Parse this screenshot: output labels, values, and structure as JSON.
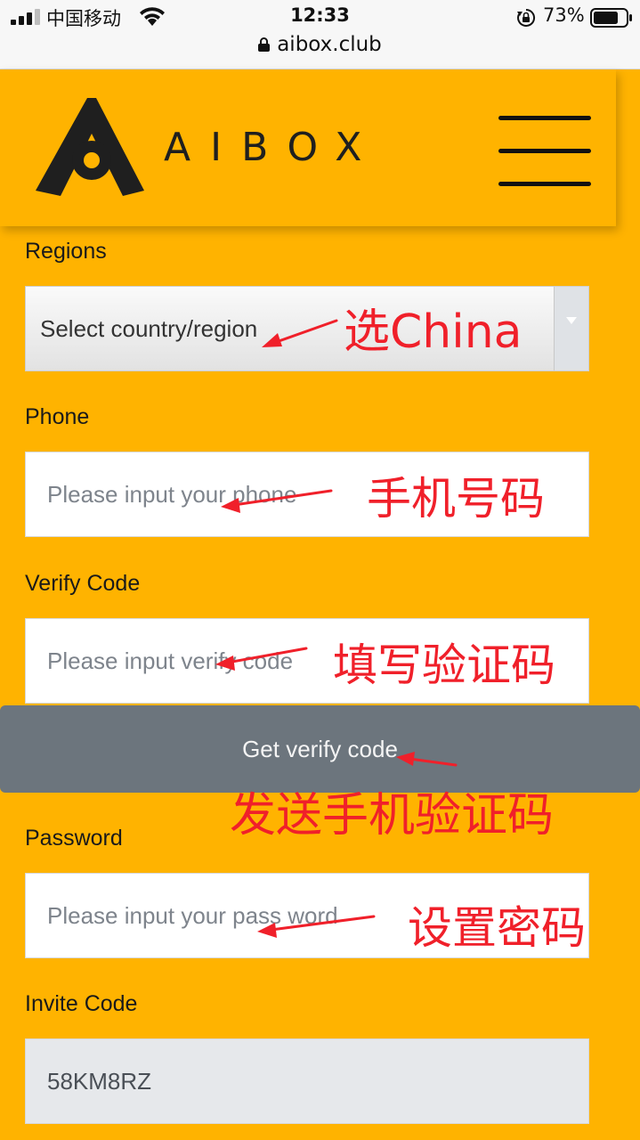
{
  "status_bar": {
    "carrier": "中国移动",
    "time": "12:33",
    "battery": "73%",
    "url": "aibox.club"
  },
  "header": {
    "logo_text": "AIBOX"
  },
  "form": {
    "regions_label": "Regions",
    "region_value": "Select country/region",
    "phone_label": "Phone",
    "phone_placeholder": "Please input your phone",
    "verify_label": "Verify Code",
    "verify_placeholder": "Please input verify code",
    "verify_button": "Get verify code",
    "password_label": "Password",
    "password_placeholder": "Please input your pass word",
    "invite_label": "Invite Code",
    "invite_value": "58KM8RZ"
  },
  "annotations": {
    "region": "选China",
    "phone": "手机号码",
    "verify_code": "填写验证码",
    "send_code": "发送手机验证码",
    "password": "设置密码"
  },
  "colors": {
    "background": "#ffb300",
    "button": "#6c757d",
    "annotation": "#f0202a"
  }
}
